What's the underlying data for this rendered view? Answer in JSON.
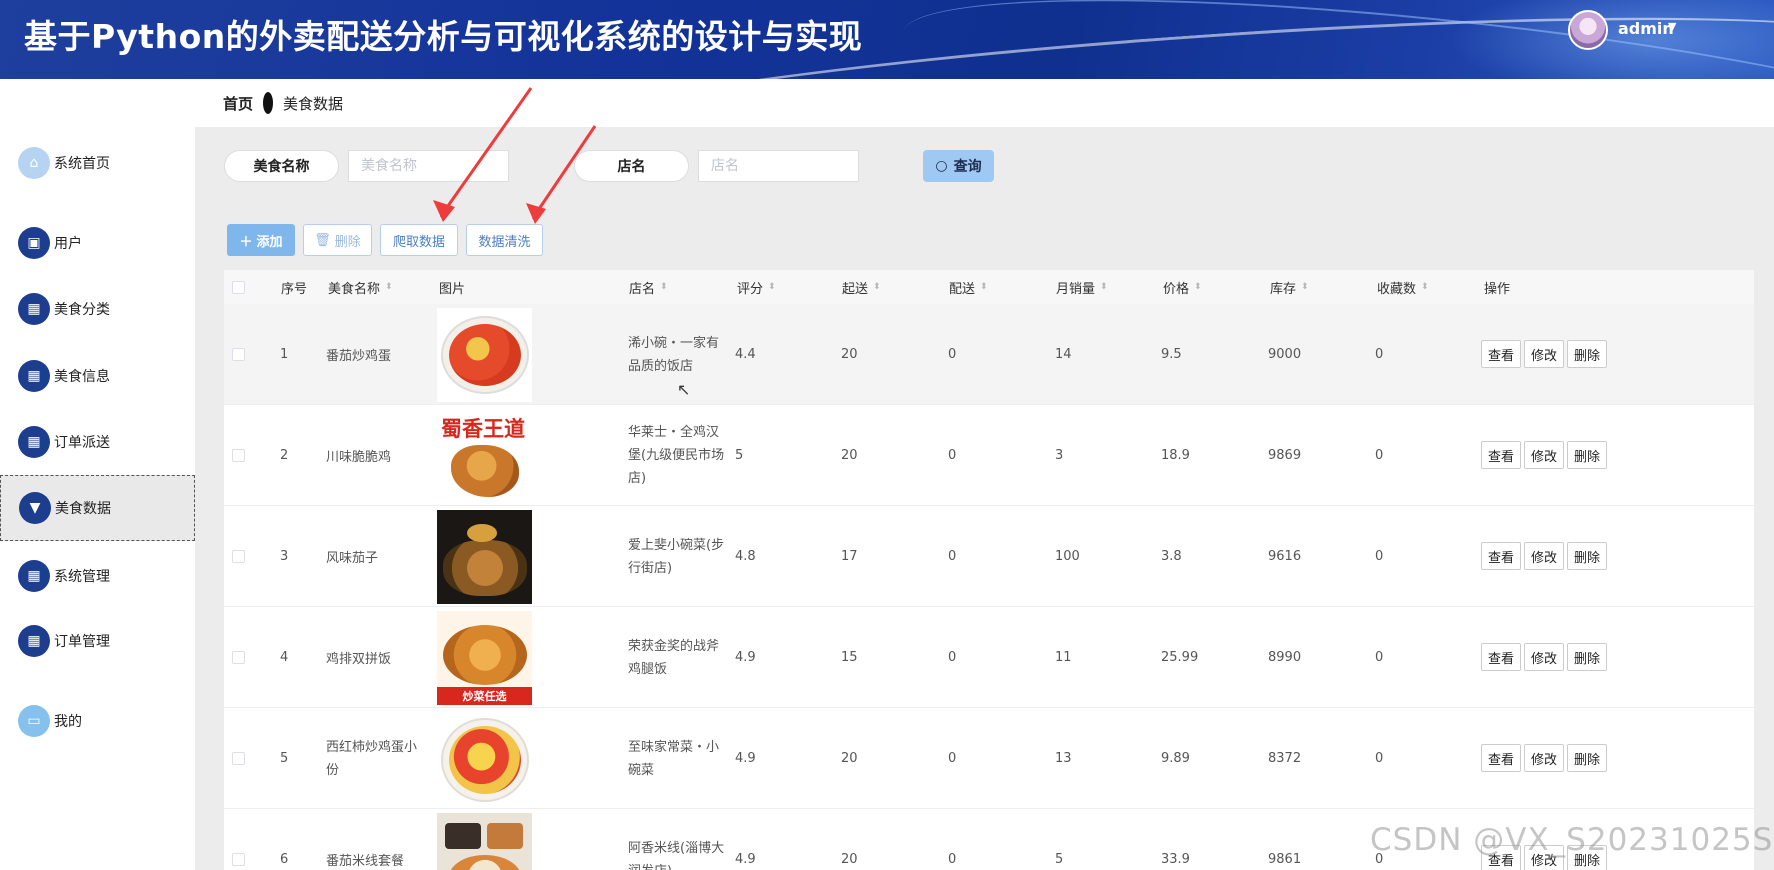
{
  "app": {
    "title": "基于Python的外卖配送分析与可视化系统的设计与实现",
    "user": "admin"
  },
  "sidebar": {
    "items": [
      {
        "label": "系统首页",
        "icon": "home-icon"
      },
      {
        "label": "用户",
        "icon": "clipboard-icon"
      },
      {
        "label": "美食分类",
        "icon": "grid-icon"
      },
      {
        "label": "美食信息",
        "icon": "grid-icon"
      },
      {
        "label": "订单派送",
        "icon": "grid-icon"
      },
      {
        "label": "美食数据",
        "icon": "pin-icon",
        "active": true
      },
      {
        "label": "系统管理",
        "icon": "apps-icon"
      },
      {
        "label": "订单管理",
        "icon": "grid-icon"
      },
      {
        "label": "我的",
        "icon": "card-icon"
      }
    ]
  },
  "breadcrumb": {
    "home": "首页",
    "current": "美食数据"
  },
  "search": {
    "name_label": "美食名称",
    "name_placeholder": "美食名称",
    "shop_label": "店名",
    "shop_placeholder": "店名",
    "query": "查询"
  },
  "actions": {
    "add": "添加",
    "delete": "删除",
    "crawl": "爬取数据",
    "clean": "数据清洗"
  },
  "table": {
    "headers": {
      "index": "序号",
      "name": "美食名称",
      "image": "图片",
      "shop": "店名",
      "rating": "评分",
      "min_order": "起送",
      "delivery": "配送",
      "monthly_sales": "月销量",
      "price": "价格",
      "stock": "库存",
      "favorites": "收藏数",
      "ops": "操作"
    },
    "ops": {
      "view": "查看",
      "edit": "修改",
      "delete": "删除"
    },
    "rows": [
      {
        "index": "1",
        "name": "番茄炒鸡蛋",
        "shop": "浠小碗・一家有品质的饭店",
        "rating": "4.4",
        "min_order": "20",
        "delivery": "0",
        "monthly_sales": "14",
        "price": "9.5",
        "stock": "9000",
        "favorites": "0"
      },
      {
        "index": "2",
        "name": "川味脆脆鸡",
        "shop": "华莱士・全鸡汉堡(九级便民市场店)",
        "rating": "5",
        "min_order": "20",
        "delivery": "0",
        "monthly_sales": "3",
        "price": "18.9",
        "stock": "9869",
        "favorites": "0"
      },
      {
        "index": "3",
        "name": "风味茄子",
        "shop": "爱上斐小碗菜(步行街店)",
        "rating": "4.8",
        "min_order": "17",
        "delivery": "0",
        "monthly_sales": "100",
        "price": "3.8",
        "stock": "9616",
        "favorites": "0"
      },
      {
        "index": "4",
        "name": "鸡排双拼饭",
        "shop": "荣获金奖的战斧鸡腿饭",
        "rating": "4.9",
        "min_order": "15",
        "delivery": "0",
        "monthly_sales": "11",
        "price": "25.99",
        "stock": "8990",
        "favorites": "0"
      },
      {
        "index": "5",
        "name": "西红柿炒鸡蛋小份",
        "shop": "至味家常菜・小碗菜",
        "rating": "4.9",
        "min_order": "20",
        "delivery": "0",
        "monthly_sales": "13",
        "price": "9.89",
        "stock": "8372",
        "favorites": "0"
      },
      {
        "index": "6",
        "name": "番茄米线套餐",
        "shop": "阿香米线(淄博大润发店)",
        "rating": "4.9",
        "min_order": "20",
        "delivery": "0",
        "monthly_sales": "5",
        "price": "33.9",
        "stock": "9861",
        "favorites": "0"
      }
    ]
  },
  "thumb_texts": {
    "row2": "蜀香王道",
    "row4": "炒菜任选"
  },
  "watermark": "CSDN @VX_S20231025S"
}
